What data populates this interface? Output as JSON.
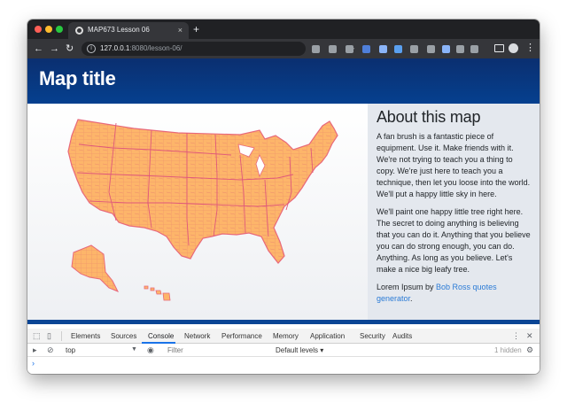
{
  "browser": {
    "tab_title": "MAP673 Lesson 06",
    "tab_close": "×",
    "new_tab": "+",
    "nav": {
      "back": "←",
      "forward": "→",
      "reload": "↻"
    },
    "url_host": "127.0.0.1",
    "url_path": ":8080/lesson-06/",
    "star": "☆",
    "menu": "⋮",
    "extension_icons": [
      "clock-icon",
      "drive-icon",
      "recycle-icon",
      "translate-icon",
      "pen-icon",
      "camera-icon",
      "cloud-icon",
      "pocket-icon",
      "share-icon",
      "info-icon",
      "grayscale-icon"
    ],
    "extension_colors": [
      "#9aa0a6",
      "#9aa0a6",
      "#9aa0a6",
      "#4f7fd9",
      "#8ab4f8",
      "#5aa0f0",
      "#9aa0a6",
      "#9aa0a6",
      "#8ab4f8",
      "#9aa0a6",
      "#9aa0a6"
    ]
  },
  "page": {
    "header_title": "Map title",
    "about_title": "About this map",
    "para1": "A fan brush is a fantastic piece of equipment. Use it. Make friends with it. We're not trying to teach you a thing to copy. We're just here to teach you a technique, then let you loose into the world. We'll put a happy little sky in here.",
    "para2": "We'll paint one happy little tree right here. The secret to doing anything is believing that you can do it. Anything that you believe you can do strong enough, you can do. Anything. As long as you believe. Let's make a nice big leafy tree.",
    "credit_prefix": "Lorem Ipsum by ",
    "credit_link": "Bob Ross quotes generator",
    "credit_suffix": ".",
    "colors": {
      "header": "#05408f",
      "map_fill": "#fdb56a",
      "map_stroke": "#e8687a",
      "link": "#2b7bd6"
    }
  },
  "devtools": {
    "tabs": [
      "Elements",
      "Sources",
      "Console",
      "Network",
      "Performance",
      "Memory",
      "Application",
      "Security",
      "Audits"
    ],
    "active_tab": "Console",
    "context": "top",
    "filter_placeholder": "Filter",
    "levels": "Default levels ▾",
    "hidden": "1 hidden",
    "prompt": "›",
    "menu": "⋮",
    "close": "✕"
  }
}
